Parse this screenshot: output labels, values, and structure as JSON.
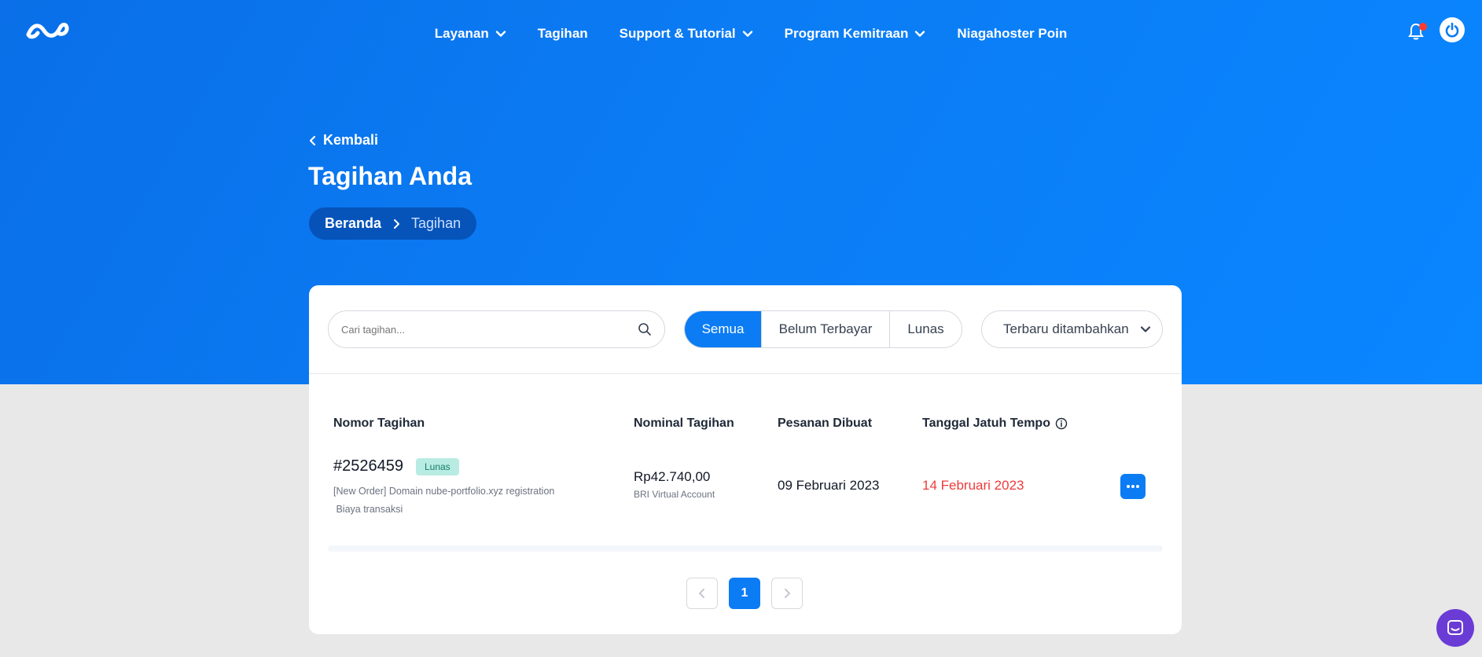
{
  "nav": {
    "items": [
      {
        "label": "Layanan",
        "dropdown": true
      },
      {
        "label": "Tagihan",
        "dropdown": false
      },
      {
        "label": "Support & Tutorial",
        "dropdown": true
      },
      {
        "label": "Program Kemitraan",
        "dropdown": true
      },
      {
        "label": "Niagahoster Poin",
        "dropdown": false
      }
    ]
  },
  "hero": {
    "back_label": "Kembali",
    "title": "Tagihan Anda",
    "breadcrumb": {
      "home": "Beranda",
      "current": "Tagihan"
    }
  },
  "toolbar": {
    "search_placeholder": "Cari tagihan...",
    "filters": [
      "Semua",
      "Belum Terbayar",
      "Lunas"
    ],
    "active_filter": "Semua",
    "sort_label": "Terbaru ditambahkan"
  },
  "table": {
    "headers": {
      "number": "Nomor Tagihan",
      "amount": "Nominal Tagihan",
      "created": "Pesanan Dibuat",
      "due": "Tanggal Jatuh Tempo"
    },
    "rows": [
      {
        "number": "#2526459",
        "status": "Lunas",
        "desc_line1": "[New Order] Domain nube-portfolio.xyz registration",
        "desc_line2": " Biaya transaksi",
        "amount": "Rp42.740,00",
        "method": "BRI Virtual Account",
        "created": "09 Februari 2023",
        "due": "14 Februari 2023"
      }
    ]
  },
  "pagination": {
    "current": "1"
  },
  "colors": {
    "primary": "#0b7cf4",
    "due_red": "#ef3b3b",
    "badge_bg": "#b8ece3",
    "chat": "#6b3bd6"
  }
}
